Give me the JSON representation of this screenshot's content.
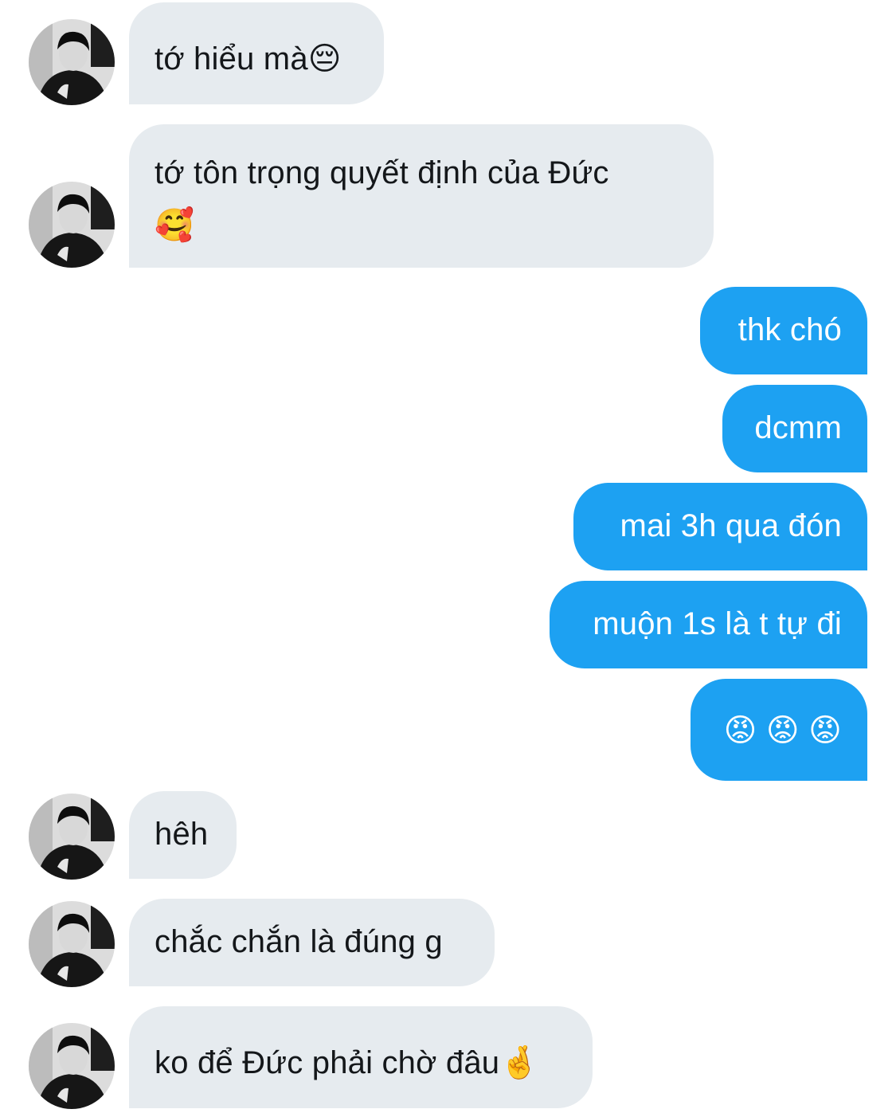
{
  "messages": [
    {
      "side": "in",
      "text": "tớ hiểu mà😔"
    },
    {
      "side": "in",
      "text": "tớ tôn trọng quyết định của Đức",
      "text2": "🥰"
    },
    {
      "side": "out",
      "text": "thk chó"
    },
    {
      "side": "out",
      "text": "dcmm"
    },
    {
      "side": "out",
      "text": "mai 3h qua đón"
    },
    {
      "side": "out",
      "text": "muộn 1s là t tự đi"
    },
    {
      "side": "out",
      "text": "😡 😡 😡"
    },
    {
      "side": "in",
      "text": "hêh"
    },
    {
      "side": "in",
      "text": "chắc chắn là đúng g"
    },
    {
      "side": "in",
      "text": "ko để Đức phải chờ đâu🤞"
    }
  ],
  "colors": {
    "incoming_bubble": "#e6ebef",
    "outgoing_bubble": "#1da1f2",
    "incoming_text": "#14171a",
    "outgoing_text": "#ffffff"
  },
  "icons": {
    "avatar": "profile-photo-avatar"
  }
}
